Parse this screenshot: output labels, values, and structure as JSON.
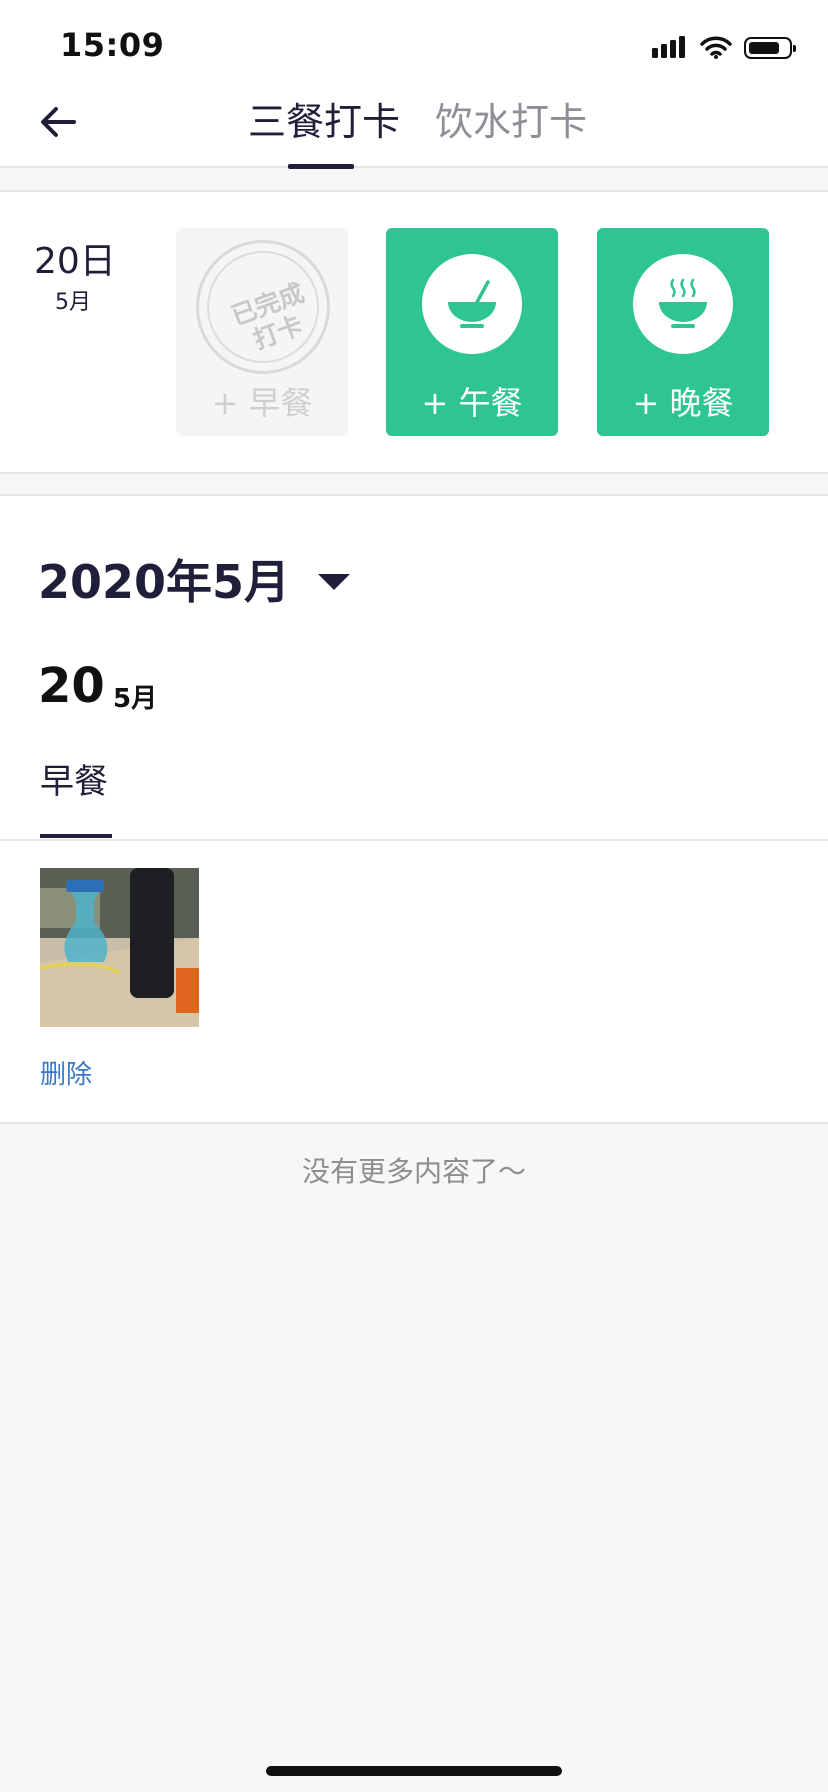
{
  "status_bar": {
    "time": "15:09",
    "icons": [
      "signal-icon",
      "wifi-icon",
      "battery-icon"
    ]
  },
  "header": {
    "back_icon": "back-arrow-icon",
    "tabs": [
      {
        "label": "三餐打卡",
        "active": true
      },
      {
        "label": "饮水打卡",
        "active": false
      }
    ]
  },
  "checkin": {
    "date": {
      "day": "20日",
      "month": "5月"
    },
    "meals": [
      {
        "label": "+ 早餐",
        "state": "done",
        "stamp_text": "已完成打卡",
        "stamp_line1": "已完成",
        "stamp_line2": "打卡"
      },
      {
        "label": "+ 午餐",
        "state": "available",
        "icon": "bowl-spoon-icon"
      },
      {
        "label": "+ 晚餐",
        "state": "available",
        "icon": "steaming-bowl-icon"
      }
    ],
    "accent_color": "#2ec591"
  },
  "history": {
    "month_selector": "2020年5月",
    "entries": [
      {
        "day": "20",
        "month": "5月",
        "meal_tabs": [
          {
            "label": "早餐",
            "active": true
          }
        ],
        "photo": "meal-photo",
        "delete_label": "删除"
      }
    ]
  },
  "footer": {
    "no_more_text": "没有更多内容了～"
  }
}
